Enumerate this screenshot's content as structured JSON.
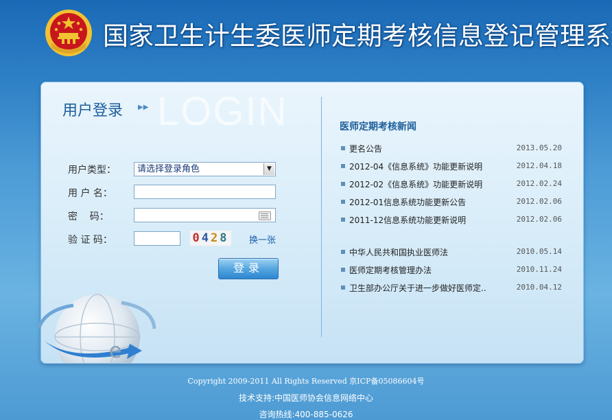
{
  "header": {
    "title": "国家卫生计生委医师定期考核信息登记管理系统",
    "emblem_icon": "national-emblem-icon",
    "colors": {
      "background": "#2d7fc5",
      "emblem_red": "#c8161e",
      "emblem_gold": "#f1c232"
    }
  },
  "login": {
    "title": "用户登录",
    "watermark": "LOGIN",
    "arrow_icon": "double-chevron-right-icon",
    "user_type_label": "用户类型：",
    "user_type_value": "请选择登录角色",
    "username_label": "用 户 名：",
    "username_value": "",
    "password_label": "密    码：",
    "password_value": "",
    "keyboard_icon": "keyboard-icon",
    "captcha_label": "验 证 码：",
    "captcha_value": "",
    "captcha_digits": [
      "0",
      "4",
      "2",
      "8"
    ],
    "refresh_label": "换一张",
    "submit_label": "登录",
    "globe_icon": "internet-globe-icon"
  },
  "news": {
    "title": "医师定期考核新闻",
    "items": [
      {
        "title": "更名公告",
        "date": "2013.05.20"
      },
      {
        "title": "2012-04《信息系统》功能更新说明",
        "date": "2012.04.18"
      },
      {
        "title": "2012-02《信息系统》功能更新说明",
        "date": "2012.02.24"
      },
      {
        "title": "2012-01信息系统功能更新公告",
        "date": "2012.02.06"
      },
      {
        "title": "2011-12信息系统功能更新说明",
        "date": "2012.02.06"
      }
    ],
    "laws": [
      {
        "title": "中华人民共和国执业医师法",
        "date": "2010.05.14"
      },
      {
        "title": "医师定期考核管理办法",
        "date": "2010.11.24"
      },
      {
        "title": "卫生部办公厅关于进一步做好医师定..",
        "date": "2010.04.12"
      }
    ]
  },
  "footer": {
    "copyright": "Copyright 2009-2011 All Rights Reserved 京ICP备05086604号",
    "support": "技术支持:中国医师协会信息网络中心",
    "hotline": "咨询热线:400-885-0626"
  }
}
